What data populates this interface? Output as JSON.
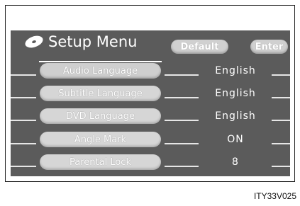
{
  "header": {
    "title": "Setup Menu",
    "default_label": "Default",
    "enter_label": "Enter"
  },
  "menu": {
    "items": [
      {
        "label": "Audio Language",
        "value": "English",
        "selected": true
      },
      {
        "label": "Subtitle Language",
        "value": "English",
        "selected": false
      },
      {
        "label": "DVD Language",
        "value": "English",
        "selected": false
      },
      {
        "label": "Angle Mark",
        "value": "ON",
        "selected": false
      },
      {
        "label": "Parental Lock",
        "value": "8",
        "selected": false
      }
    ]
  },
  "caption": "ITY33V025",
  "colors": {
    "screen_background": "#5b5b5b",
    "button_fill": "#d6d6d6",
    "text": "#ffffff"
  }
}
